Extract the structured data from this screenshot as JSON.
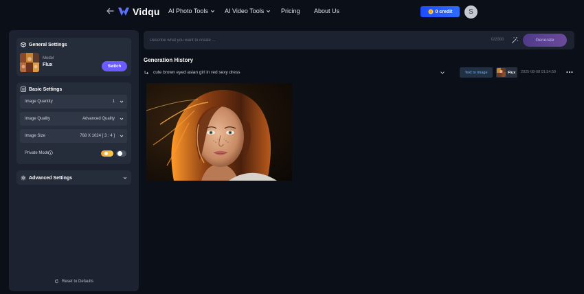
{
  "nav": {
    "brand": "Vidqu",
    "items": [
      {
        "label": "AI Photo Tools",
        "dropdown": true
      },
      {
        "label": "AI Video Tools",
        "dropdown": true
      },
      {
        "label": "Pricing",
        "dropdown": false
      },
      {
        "label": "About Us",
        "dropdown": false
      }
    ],
    "credit_label": "0 credit",
    "avatar_initial": "S",
    "accent_color": "#2d6bff"
  },
  "sidebar": {
    "general": {
      "title": "General Settings",
      "model_caption": "Model",
      "model_name": "Flux",
      "switch_label": "Switch"
    },
    "basic": {
      "title": "Basic Settings",
      "rows": [
        {
          "label": "Image Quantity",
          "value": "1"
        },
        {
          "label": "Image Quality",
          "value": "Advanced Quality"
        },
        {
          "label": "Image Size",
          "value": "768 X 1024 [ 3 : 4 ]"
        }
      ],
      "private_mode_label": "Private Mode"
    },
    "advanced": {
      "title": "Advanced Settings"
    },
    "reset_label": "Reset to Defaults"
  },
  "prompt": {
    "placeholder": "Describe what you want to create ...",
    "counter": "0/2000",
    "generate_label": "Generate",
    "generate_color": "#6b4a9a"
  },
  "history": {
    "title": "Generation History",
    "entries": [
      {
        "prompt": "cute brown eyed asian girl in red sexy dress",
        "mode_tag": "Text to Image",
        "model_tag": "Flux",
        "timestamp": "2025-08-08 01:54:59"
      }
    ]
  },
  "icons": {
    "back": "arrow-left-icon",
    "coin": "coin-icon",
    "general": "cube-icon",
    "basic": "sliders-icon",
    "advanced": "gear-icon",
    "reset": "refresh-icon",
    "magic": "magic-wand-icon",
    "more": "more-horizontal-icon"
  }
}
